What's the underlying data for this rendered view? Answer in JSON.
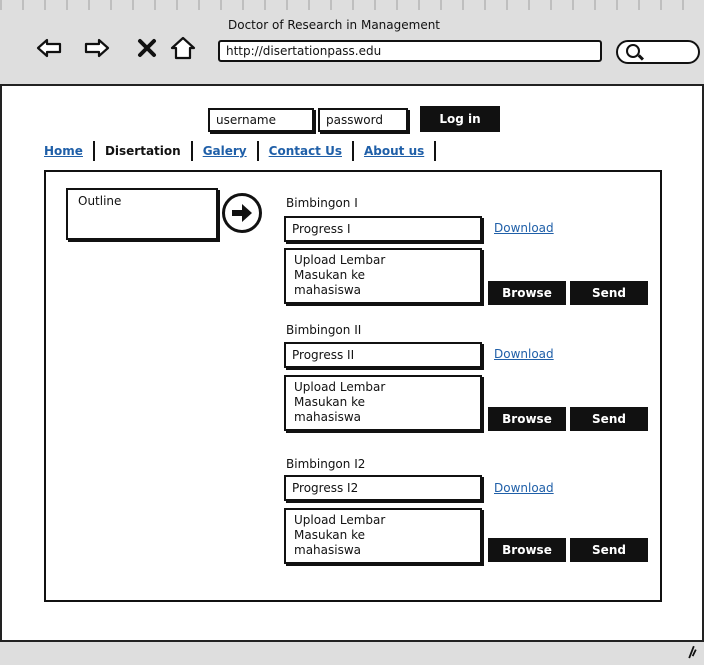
{
  "window": {
    "title": "Doctor of Research in Management"
  },
  "toolbar": {
    "back_icon": "back-arrow-icon",
    "forward_icon": "forward-arrow-icon",
    "close_icon": "close-icon",
    "home_icon": "home-icon",
    "url": "http://disertationpass.edu",
    "search_icon": "search-icon"
  },
  "login": {
    "username": "username",
    "password": "password",
    "button": "Log in"
  },
  "menu": {
    "items": [
      {
        "label": "Home"
      },
      {
        "label": "Disertation"
      },
      {
        "label": "Galery"
      },
      {
        "label": "Contact Us"
      },
      {
        "label": "About us"
      }
    ]
  },
  "outline": {
    "label": "Outline",
    "arrow_icon": "arrow-right-circle-icon"
  },
  "sections": [
    {
      "title": "Bimbingon I",
      "progress": "Progress I",
      "download": "Download",
      "upload_lines": [
        "Upload Lembar",
        "Masukan ke",
        "mahasiswa"
      ],
      "browse": "Browse",
      "send": "Send"
    },
    {
      "title": "Bimbingon II",
      "progress": "Progress II",
      "download": "Download",
      "upload_lines": [
        "Upload Lembar",
        "Masukan ke",
        "mahasiswa"
      ],
      "browse": "Browse",
      "send": "Send"
    },
    {
      "title": "Bimbingon I2",
      "progress": "Progress I2",
      "download": "Download",
      "upload_lines": [
        "Upload Lembar",
        "Masukan ke",
        "mahasiswa"
      ],
      "browse": "Browse",
      "send": "Send"
    }
  ],
  "colors": {
    "link": "#1f5fa8",
    "chrome": "#dedede",
    "ink": "#111111"
  }
}
